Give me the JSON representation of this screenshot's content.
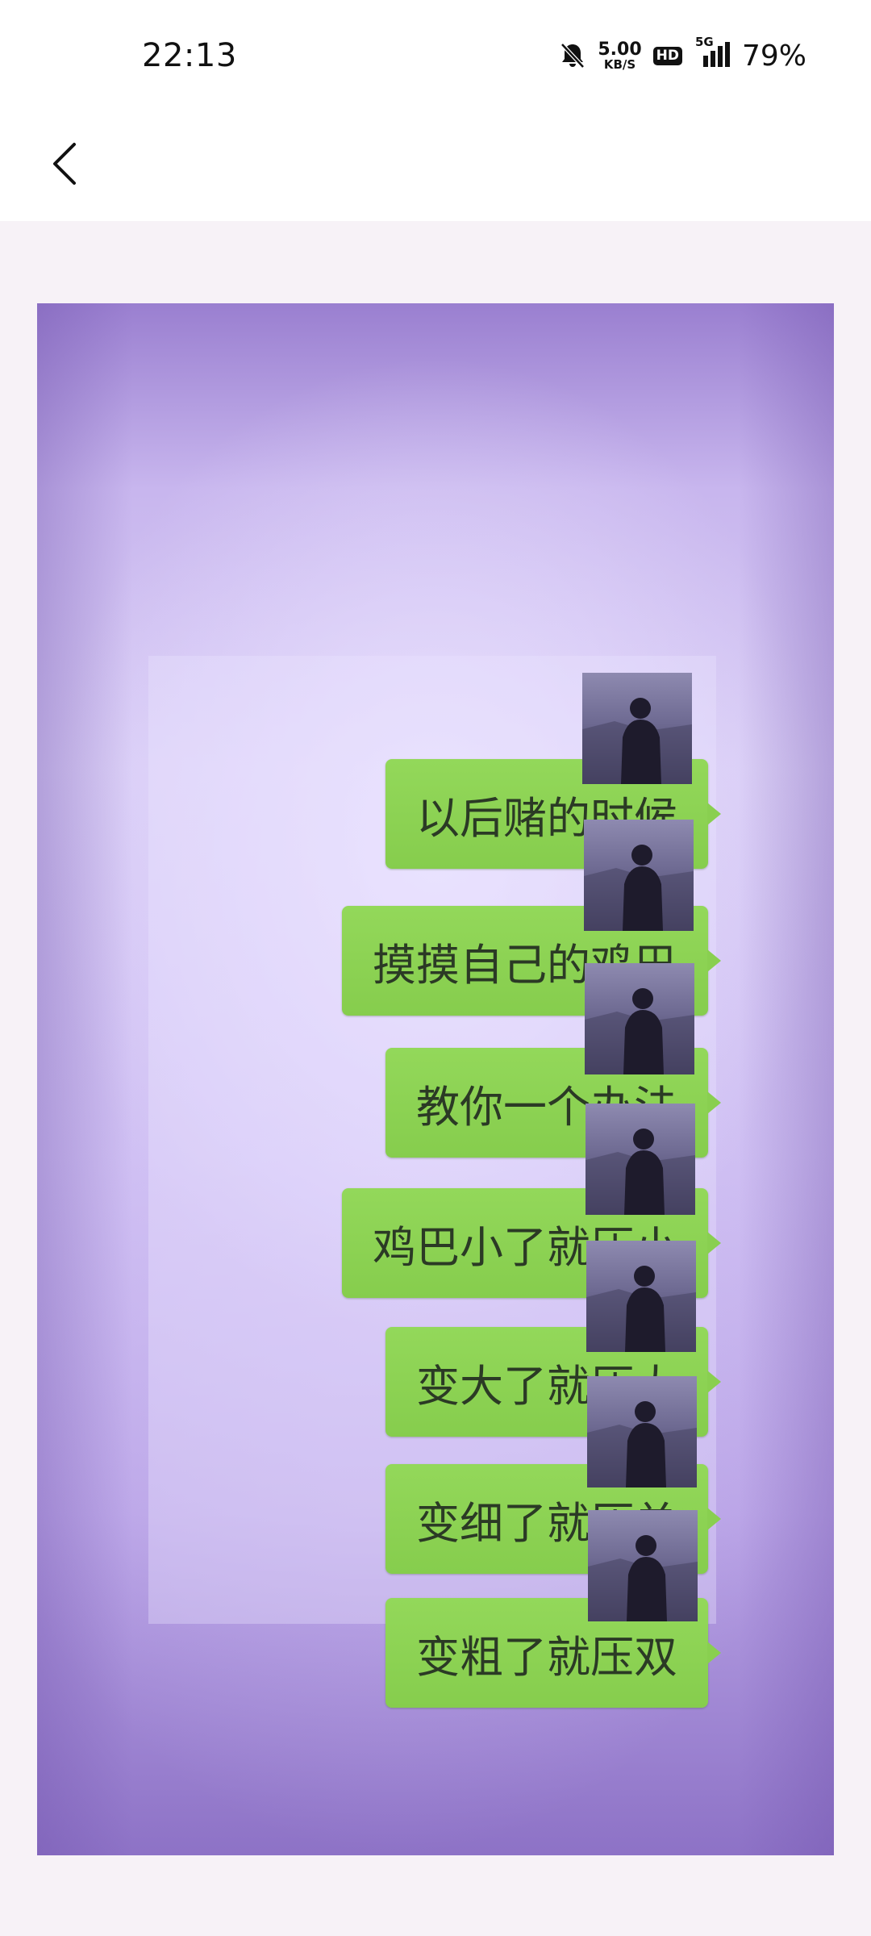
{
  "status_bar": {
    "time": "22:13",
    "net_speed_value": "5.00",
    "net_speed_unit": "KB/S",
    "hd_badge": "HD",
    "network_type": "5G",
    "battery": "79%"
  },
  "nav": {
    "back_icon": "chevron-left-icon"
  },
  "photo": {
    "messages": [
      {
        "text": "以后赌的时候"
      },
      {
        "text": "摸摸自己的鸡巴"
      },
      {
        "text": "教你一个办法"
      },
      {
        "text": "鸡巴小了就压小"
      },
      {
        "text": "变大了就压大"
      },
      {
        "text": "变细了就压单"
      },
      {
        "text": "变粗了就压双"
      }
    ],
    "colors": {
      "bubble": "#8bd153",
      "background": "#cdbdf1"
    }
  }
}
